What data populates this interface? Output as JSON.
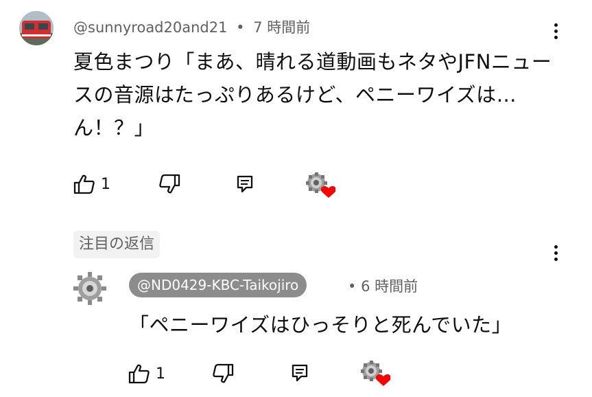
{
  "comment": {
    "author": "@sunnyroad20and21",
    "separator": "•",
    "time": "7 時間前",
    "text": "夏色まつり「まあ、晴れる道動画もネタやJFNニュースの音源はたっぷりあるけど、ペニーワイズは…ん！？」",
    "likes": "1"
  },
  "pinned_label": "注目の返信",
  "reply": {
    "author": "@ND0429-KBC-Taikojiro",
    "separator": "•",
    "time": "6 時間前",
    "text": "「ペニーワイズはひっそりと死んでいた」",
    "likes": "1"
  },
  "colors": {
    "heart": "#ff0000",
    "muted": "#606060",
    "chip": "#8c8c8c"
  }
}
